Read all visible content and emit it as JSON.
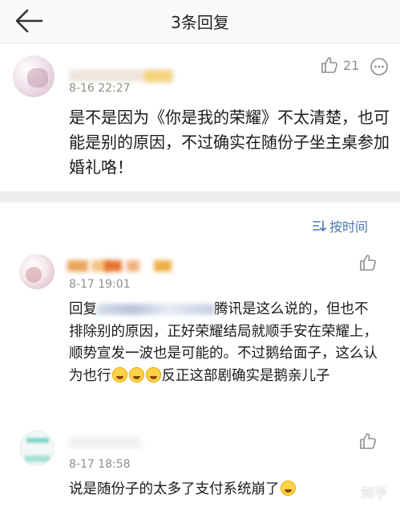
{
  "header": {
    "title": "3条回复",
    "back_icon": "arrow-left-icon"
  },
  "main_comment": {
    "timestamp": "8-16 22:27",
    "like_count": "21",
    "text": "是不是因为《你是我的荣耀》不太清楚，也可能是别的原因，不过确实在随份子坐主桌参加婚礼咯！"
  },
  "sort": {
    "label": "按时间",
    "icon": "sort-icon"
  },
  "replies": [
    {
      "timestamp": "8-17 19:01",
      "text_prefix": "回复",
      "text_after_mask": "腾讯是这么说的，但也不排除别的原因，正好荣耀结局就顺手安在荣耀上，顺势宣发一波也是可能的。不过鹅给面子，这么认为也行",
      "text_end": "反正这部剧确实是鹅亲儿子"
    },
    {
      "timestamp": "8-17 18:58",
      "text": "说是随份子的太多了支付系统崩了"
    }
  ],
  "watermark": "知乎",
  "colors": {
    "accent": "#4a78b0",
    "muted": "#8e8e8e",
    "separator": "#eeeeee"
  }
}
